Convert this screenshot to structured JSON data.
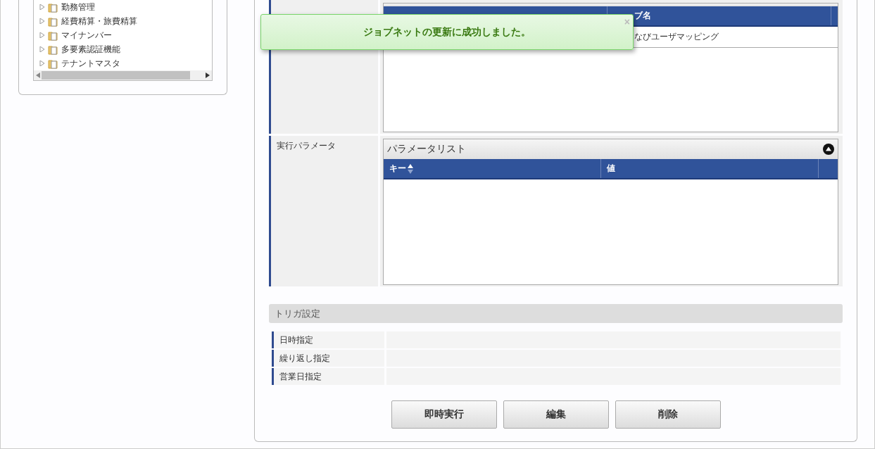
{
  "tree": {
    "items": [
      {
        "label": "勤務管理",
        "expanded": false
      },
      {
        "label": "経費精算・旅費精算",
        "expanded": false
      },
      {
        "label": "マイナンバー",
        "expanded": false
      },
      {
        "label": "多要素認証機能",
        "expanded": false
      },
      {
        "label": "テナントマスタ",
        "expanded": false
      }
    ]
  },
  "job_grid": {
    "columns": [
      "",
      "ブ名"
    ],
    "rows": [
      [
        "",
        "なびユーザマッピング"
      ]
    ]
  },
  "toast": {
    "message": "ジョブネットの更新に成功しました。",
    "close": "×"
  },
  "parameters": {
    "label": "実行パラメータ",
    "title": "パラメータリスト",
    "expanded": true,
    "columns": [
      {
        "label": "キー",
        "sortable": true
      },
      {
        "label": "値",
        "sortable": false
      }
    ]
  },
  "trigger": {
    "title": "トリガ設定",
    "rows": [
      {
        "label": "日時指定"
      },
      {
        "label": "繰り返し指定"
      },
      {
        "label": "営業日指定"
      }
    ]
  },
  "buttons": [
    "即時実行",
    "編集",
    "削除"
  ]
}
